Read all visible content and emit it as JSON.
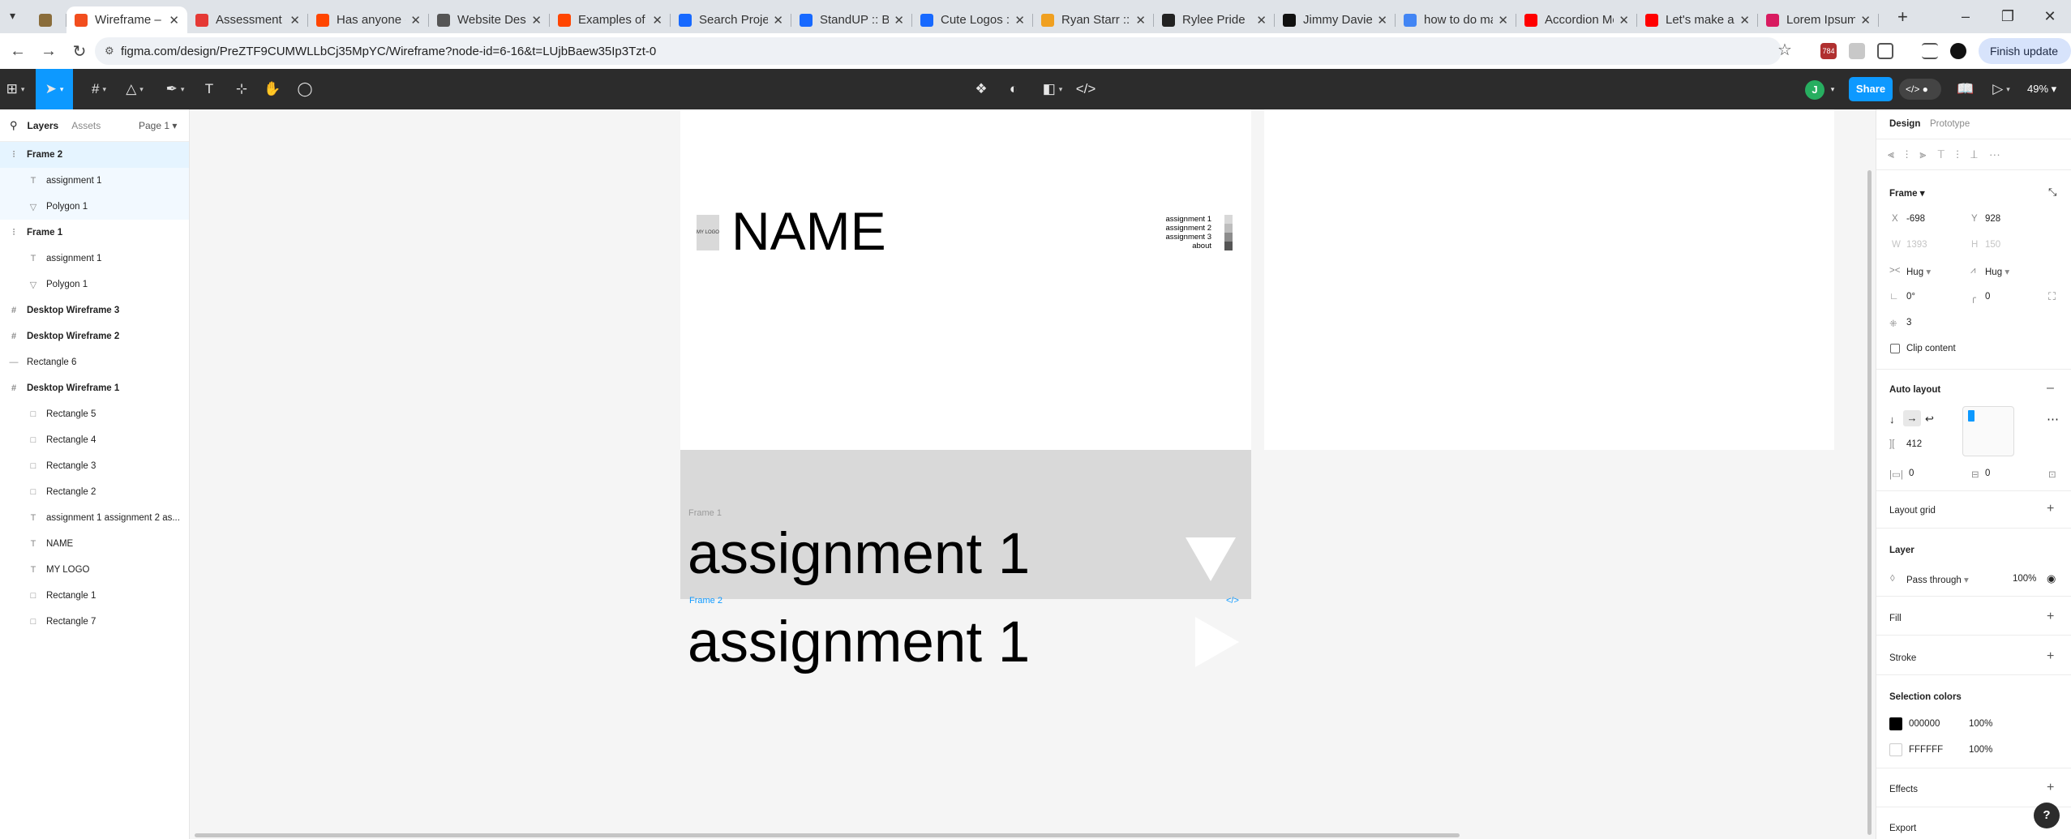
{
  "browser": {
    "tabs": [
      {
        "title": "",
        "color": "#8a6d3b"
      },
      {
        "title": "Wireframe – Fi",
        "color": "#f24e1e",
        "active": true
      },
      {
        "title": "Assessment Ta",
        "color": "#e53935"
      },
      {
        "title": "Has anyone els",
        "color": "#ff4500"
      },
      {
        "title": "Website Desig",
        "color": "#555555"
      },
      {
        "title": "Examples of a",
        "color": "#ff4500"
      },
      {
        "title": "Search Project",
        "color": "#1769ff"
      },
      {
        "title": "StandUP :: Beh",
        "color": "#1769ff"
      },
      {
        "title": "Cute Logos :: B",
        "color": "#1769ff"
      },
      {
        "title": "Ryan Starr :::",
        "color": "#f0a020"
      },
      {
        "title": "Rylee Pride",
        "color": "#222222"
      },
      {
        "title": "Jimmy Davies",
        "color": "#111111"
      },
      {
        "title": "how to do mak",
        "color": "#4285f4"
      },
      {
        "title": "Accordion Mer",
        "color": "#ff0000"
      },
      {
        "title": "Let's make a b",
        "color": "#ff0000"
      },
      {
        "title": "Lorem Ipsum",
        "color": "#d81b60"
      }
    ],
    "url": "figma.com/design/PreZTF9CUMWLLbCj35MpYC/Wireframe?node-id=6-16&t=LUjbBaew35Ip3Tzt-0",
    "badge": "784",
    "finish_update": "Finish update"
  },
  "toolbar": {
    "avatar": "J",
    "share": "Share",
    "zoom": "49%"
  },
  "layers_panel": {
    "tab_layers": "Layers",
    "tab_assets": "Assets",
    "page": "Page 1",
    "items": [
      {
        "label": "Frame 2",
        "icon": "autolayout-icon",
        "bold": true,
        "indent": 0
      },
      {
        "label": "assignment 1",
        "icon": "text-icon",
        "bold": false,
        "indent": 1
      },
      {
        "label": "Polygon 1",
        "icon": "polygon-icon",
        "bold": false,
        "indent": 1
      },
      {
        "label": "Frame 1",
        "icon": "autolayout-icon",
        "bold": true,
        "indent": 0
      },
      {
        "label": "assignment 1",
        "icon": "text-icon",
        "bold": false,
        "indent": 1
      },
      {
        "label": "Polygon 1",
        "icon": "polygon-icon",
        "bold": false,
        "indent": 1
      },
      {
        "label": "Desktop Wireframe 3",
        "icon": "frame-icon",
        "bold": true,
        "indent": 0
      },
      {
        "label": "Desktop Wireframe 2",
        "icon": "frame-icon",
        "bold": true,
        "indent": 0
      },
      {
        "label": "Rectangle 6",
        "icon": "line-icon",
        "bold": false,
        "indent": 0
      },
      {
        "label": "Desktop Wireframe 1",
        "icon": "frame-icon",
        "bold": true,
        "indent": 0
      },
      {
        "label": "Rectangle 5",
        "icon": "rectangle-icon",
        "bold": false,
        "indent": 1
      },
      {
        "label": "Rectangle 4",
        "icon": "rectangle-icon",
        "bold": false,
        "indent": 1
      },
      {
        "label": "Rectangle 3",
        "icon": "rectangle-icon",
        "bold": false,
        "indent": 1
      },
      {
        "label": "Rectangle 2",
        "icon": "rectangle-icon",
        "bold": false,
        "indent": 1
      },
      {
        "label": "assignment 1 assignment 2 as...",
        "icon": "text-icon",
        "bold": false,
        "indent": 1
      },
      {
        "label": "NAME",
        "icon": "text-icon",
        "bold": false,
        "indent": 1
      },
      {
        "label": "MY LOGO",
        "icon": "text-icon",
        "bold": false,
        "indent": 1
      },
      {
        "label": "Rectangle 1",
        "icon": "rectangle-icon",
        "bold": false,
        "indent": 1
      },
      {
        "label": "Rectangle 7",
        "icon": "rectangle-icon",
        "bold": false,
        "indent": 1
      }
    ]
  },
  "canvas": {
    "logo_text": "MY LOGO",
    "name_text": "NAME",
    "menu_lines": [
      "assignment 1",
      "assignment 2",
      "assignment 3",
      "about"
    ],
    "frame1_label": "Frame 1",
    "frame1_text": "assignment 1",
    "frame2_label": "Frame 2",
    "frame2_code": "</>",
    "frame2_text": "assignment 1"
  },
  "design_panel": {
    "tab_design": "Design",
    "tab_prototype": "Prototype",
    "frame_section": "Frame",
    "x_label": "X",
    "x_value": "-698",
    "y_label": "Y",
    "y_value": "928",
    "w_label": "W",
    "w_value": "1393",
    "h_label": "H",
    "h_value": "150",
    "hug_w": "Hug",
    "hug_h": "Hug",
    "rotation": "0°",
    "radius": "0",
    "count": "3",
    "clip_content": "Clip content",
    "auto_layout": "Auto layout",
    "gap": "412",
    "padding_h": "0",
    "padding_v": "0",
    "layout_grid": "Layout grid",
    "layer": "Layer",
    "blend": "Pass through",
    "opacity": "100%",
    "fill": "Fill",
    "stroke": "Stroke",
    "selection_colors": "Selection colors",
    "colors": [
      {
        "hex": "000000",
        "opacity": "100%",
        "swatch": "#000000"
      },
      {
        "hex": "FFFFFF",
        "opacity": "100%",
        "swatch": "#ffffff"
      }
    ],
    "effects": "Effects",
    "export": "Export"
  },
  "help": "?"
}
